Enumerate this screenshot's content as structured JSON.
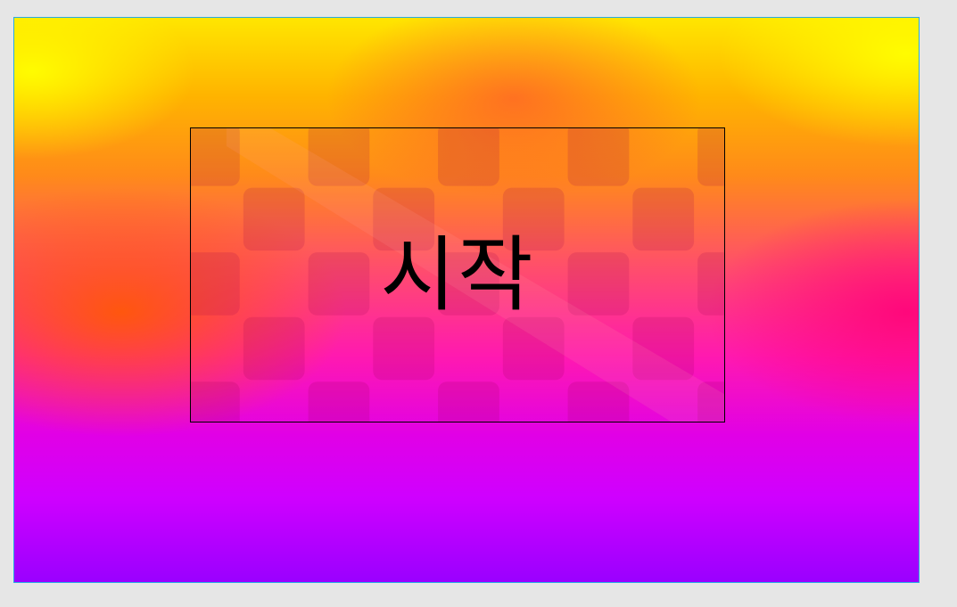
{
  "game": {
    "start_button_label": "시작"
  },
  "colors": {
    "canvas_border": "#29abe2",
    "page_background": "#e6e6e6",
    "gradient_top": "#ffe600",
    "gradient_mid": "#ff19b0",
    "gradient_bottom": "#9a00ff"
  }
}
